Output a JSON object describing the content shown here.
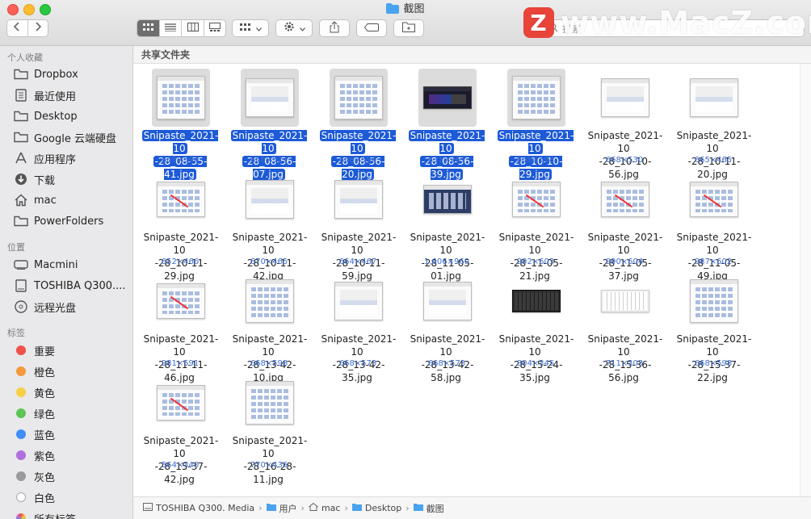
{
  "window": {
    "title": "截图"
  },
  "watermark": {
    "text": "www.MacZ.com",
    "logo_letter": "Z"
  },
  "search": {
    "placeholder": "搜索"
  },
  "sidebar": {
    "favorites_header": "个人收藏",
    "favorites": [
      {
        "label": "Dropbox",
        "icon": "folder-icon"
      },
      {
        "label": "最近使用",
        "icon": "recents-icon"
      },
      {
        "label": "Desktop",
        "icon": "folder-icon"
      },
      {
        "label": "Google 云端硬盘",
        "icon": "folder-icon"
      },
      {
        "label": "应用程序",
        "icon": "applications-icon"
      },
      {
        "label": "下载",
        "icon": "download-icon"
      },
      {
        "label": "mac",
        "icon": "home-icon"
      },
      {
        "label": "PowerFolders",
        "icon": "folder-icon"
      }
    ],
    "locations_header": "位置",
    "locations": [
      {
        "label": "Macmini",
        "icon": "computer-icon"
      },
      {
        "label": "TOSHIBA Q300....",
        "icon": "disk-icon"
      },
      {
        "label": "远程光盘",
        "icon": "optical-disc-icon"
      }
    ],
    "tags_header": "标签",
    "tags": [
      {
        "label": "重要",
        "color": "#f0524a"
      },
      {
        "label": "橙色",
        "color": "#f3993d"
      },
      {
        "label": "黄色",
        "color": "#f7cf47"
      },
      {
        "label": "绿色",
        "color": "#5dc456"
      },
      {
        "label": "蓝色",
        "color": "#3f8ef7"
      },
      {
        "label": "紫色",
        "color": "#b16fdd"
      },
      {
        "label": "灰色",
        "color": "#9a9a9e"
      },
      {
        "label": "白色",
        "color": "#ffffff"
      },
      {
        "label": "所有标签…",
        "color": ""
      }
    ]
  },
  "content": {
    "section_title": "共享文件夹",
    "files": [
      {
        "line1": "Snipaste_2021-10",
        "line2": "-28_08-55-41.jpg",
        "dims": "668×598",
        "selected": true,
        "style": "grid"
      },
      {
        "line1": "Snipaste_2021-10",
        "line2": "-28_08-56-07.jpg",
        "dims": "668×521",
        "selected": true,
        "style": "dialog"
      },
      {
        "line1": "Snipaste_2021-10",
        "line2": "-28_08-56-20.jpg",
        "dims": "668×598",
        "selected": true,
        "style": "grid"
      },
      {
        "line1": "Snipaste_2021-10",
        "line2": "-28_08-56-39.jpg",
        "dims": "631×269",
        "selected": true,
        "style": "dark"
      },
      {
        "line1": "Snipaste_2021-10",
        "line2": "-28_10-10-29.jpg",
        "dims": "668×598",
        "selected": true,
        "style": "grid"
      },
      {
        "line1": "Snipaste_2021-10",
        "line2": "-28_10-10-56.jpg",
        "dims": "668×530",
        "selected": false,
        "style": "dialog"
      },
      {
        "line1": "Snipaste_2021-10",
        "line2": "-28_10-11-20.jpg",
        "dims": "665×465",
        "selected": false,
        "style": "dialog"
      },
      {
        "line1": "Snipaste_2021-10",
        "line2": "-28_10-11-29.jpg",
        "dims": "652×466",
        "selected": false,
        "style": "arrow"
      },
      {
        "line1": "Snipaste_2021-10",
        "line2": "-28_10-11-42.jpg",
        "dims": "670×465",
        "selected": false,
        "style": "dialog"
      },
      {
        "line1": "Snipaste_2021-10",
        "line2": "-28_10-11-59.jpg",
        "dims": "664×467",
        "selected": false,
        "style": "dialog"
      },
      {
        "line1": "Snipaste_2021-10",
        "line2": "-28_11-05-01.jpg",
        "dims": "1,606×960",
        "selected": false,
        "style": "desk"
      },
      {
        "line1": "Snipaste_2021-10",
        "line2": "-28_11-05-21.jpg",
        "dims": "992×603",
        "selected": false,
        "style": "arrow"
      },
      {
        "line1": "Snipaste_2021-10",
        "line2": "-28_11-05-37.jpg",
        "dims": "990×604",
        "selected": false,
        "style": "arrow"
      },
      {
        "line1": "Snipaste_2021-10",
        "line2": "-28_11-05-49.jpg",
        "dims": "987×602",
        "selected": false,
        "style": "arrow"
      },
      {
        "line1": "Snipaste_2021-10",
        "line2": "-28_11-11-46.jpg",
        "dims": "981×591",
        "selected": false,
        "style": "arrow"
      },
      {
        "line1": "Snipaste_2021-10",
        "line2": "-28_13-42-10.jpg",
        "dims": "668×598",
        "selected": false,
        "style": "grid"
      },
      {
        "line1": "Snipaste_2021-10",
        "line2": "-28_13-42-35.jpg",
        "dims": "668×573",
        "selected": false,
        "style": "dialog"
      },
      {
        "line1": "Snipaste_2021-10",
        "line2": "-28_13-42-58.jpg",
        "dims": "668×573",
        "selected": false,
        "style": "dialog"
      },
      {
        "line1": "Snipaste_2021-10",
        "line2": "-28_15-24-35.jpg",
        "dims": "804×345",
        "selected": false,
        "style": "kbd"
      },
      {
        "line1": "Snipaste_2021-10",
        "line2": "-28_15-36-56.jpg",
        "dims": "711×303",
        "selected": false,
        "style": "kbdw"
      },
      {
        "line1": "Snipaste_2021-10",
        "line2": "-28_15-37-22.jpg",
        "dims": "668×598",
        "selected": false,
        "style": "grid"
      },
      {
        "line1": "Snipaste_2021-10",
        "line2": "-28_15-37-42.jpg",
        "dims": "564×340",
        "selected": false,
        "style": "arrow"
      },
      {
        "line1": "Snipaste_2021-10",
        "line2": "-28_16-28-11.jpg",
        "dims": "770×436",
        "selected": false,
        "style": "grid"
      }
    ]
  },
  "pathbar": [
    "TOSHIBA Q300. Media",
    "用户",
    "mac",
    "Desktop",
    "截图"
  ]
}
